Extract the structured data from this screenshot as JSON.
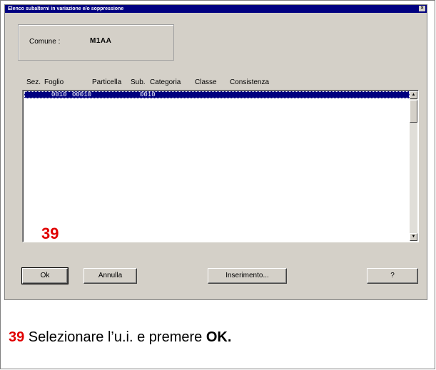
{
  "window": {
    "title": "Elenco subalterni in variazione e/o soppressione",
    "close_glyph": "×"
  },
  "comune": {
    "label": "Comune :",
    "value": "M1AA"
  },
  "list": {
    "headers": [
      "Sez.",
      "Foglio",
      "Particella",
      "Sub.",
      "Categoria",
      "Classe",
      "Consistenza"
    ],
    "rows": [
      {
        "sez": "",
        "foglio": "0010",
        "particella": "00010",
        "sub": "0010",
        "categoria": "",
        "classe": "",
        "consistenza": "",
        "selected": true
      }
    ]
  },
  "step_number": "39",
  "buttons": {
    "ok": "Ok",
    "annulla": "Annulla",
    "inserimento": "Inserimento...",
    "help": "?"
  },
  "caption": {
    "number": "39",
    "text": " Selezionare l’u.i. e premere ",
    "bold": "OK."
  },
  "colors": {
    "titlebar": "#000080",
    "selection": "#000080",
    "step_red": "#e00000",
    "dialog_bg": "#d4d0c8"
  }
}
